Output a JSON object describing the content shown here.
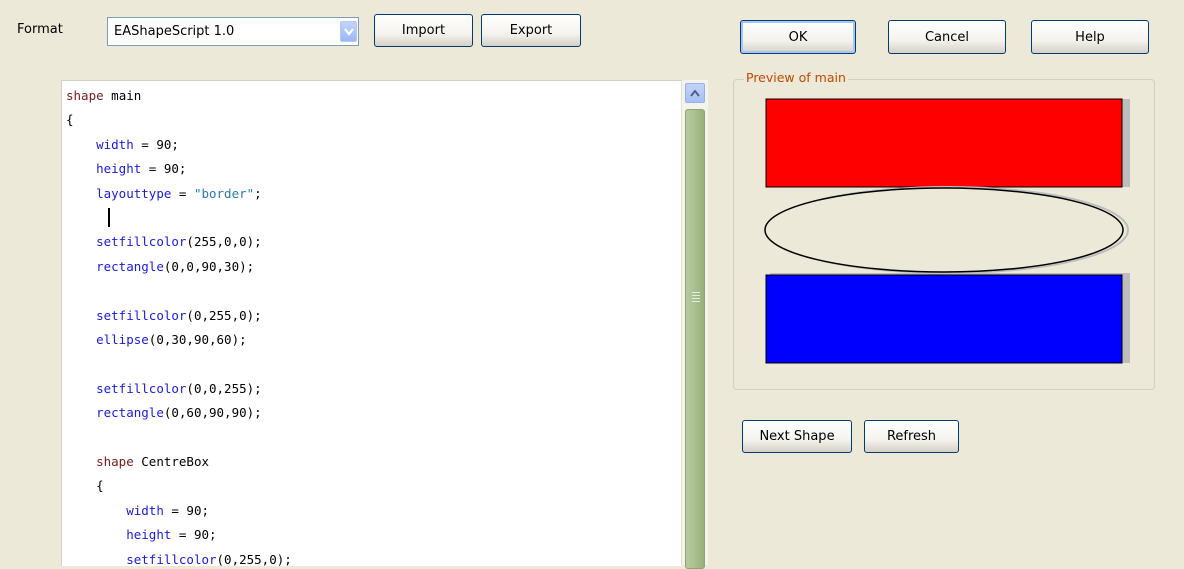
{
  "toolbar": {
    "format_label": "Format",
    "format_value": "EAShapeScript 1.0",
    "import_label": "Import",
    "export_label": "Export"
  },
  "dialog_buttons": {
    "ok_label": "OK",
    "cancel_label": "Cancel",
    "help_label": "Help"
  },
  "preview": {
    "group_label": "Preview of main",
    "shapes": [
      {
        "kind": "rectangle",
        "fill": "#FF0000"
      },
      {
        "kind": "ellipse",
        "fill": "#ECE9D8"
      },
      {
        "kind": "rectangle",
        "fill": "#0000FF"
      }
    ]
  },
  "shape_nav": {
    "next_label": "Next Shape",
    "refresh_label": "Refresh"
  },
  "code": {
    "lines": [
      [
        [
          "kw",
          "shape"
        ],
        [
          "plain",
          " main"
        ]
      ],
      [
        [
          "plain",
          "{"
        ]
      ],
      [
        [
          "plain",
          "    "
        ],
        [
          "prop",
          "width"
        ],
        [
          "plain",
          " = 90;"
        ]
      ],
      [
        [
          "plain",
          "    "
        ],
        [
          "prop",
          "height"
        ],
        [
          "plain",
          " = 90;"
        ]
      ],
      [
        [
          "plain",
          "    "
        ],
        [
          "prop",
          "layouttype"
        ],
        [
          "plain",
          " = "
        ],
        [
          "str",
          "\"border\""
        ],
        [
          "plain",
          ";"
        ]
      ],
      [],
      [
        [
          "plain",
          "    "
        ],
        [
          "fn",
          "setfillcolor"
        ],
        [
          "plain",
          "(255,0,0);"
        ]
      ],
      [
        [
          "plain",
          "    "
        ],
        [
          "fn",
          "rectangle"
        ],
        [
          "plain",
          "(0,0,90,30);"
        ]
      ],
      [],
      [
        [
          "plain",
          "    "
        ],
        [
          "fn",
          "setfillcolor"
        ],
        [
          "plain",
          "(0,255,0);"
        ]
      ],
      [
        [
          "plain",
          "    "
        ],
        [
          "fn",
          "ellipse"
        ],
        [
          "plain",
          "(0,30,90,60);"
        ]
      ],
      [],
      [
        [
          "plain",
          "    "
        ],
        [
          "fn",
          "setfillcolor"
        ],
        [
          "plain",
          "(0,0,255);"
        ]
      ],
      [
        [
          "plain",
          "    "
        ],
        [
          "fn",
          "rectangle"
        ],
        [
          "plain",
          "(0,60,90,90);"
        ]
      ],
      [],
      [
        [
          "plain",
          "    "
        ],
        [
          "kw",
          "shape"
        ],
        [
          "plain",
          " CentreBox"
        ]
      ],
      [
        [
          "plain",
          "    {"
        ]
      ],
      [
        [
          "plain",
          "        "
        ],
        [
          "prop",
          "width"
        ],
        [
          "plain",
          " = 90;"
        ]
      ],
      [
        [
          "plain",
          "        "
        ],
        [
          "prop",
          "height"
        ],
        [
          "plain",
          " = 90;"
        ]
      ],
      [
        [
          "plain",
          "        "
        ],
        [
          "fn",
          "setfillcolor"
        ],
        [
          "plain",
          "(0,255,0);"
        ]
      ]
    ]
  },
  "colors": {
    "dialog_bg": "#ECE9D8",
    "keyword": "#7B1A1A",
    "property": "#1A1AE0",
    "string": "#2A7AA8",
    "group_label": "#C04A00"
  }
}
